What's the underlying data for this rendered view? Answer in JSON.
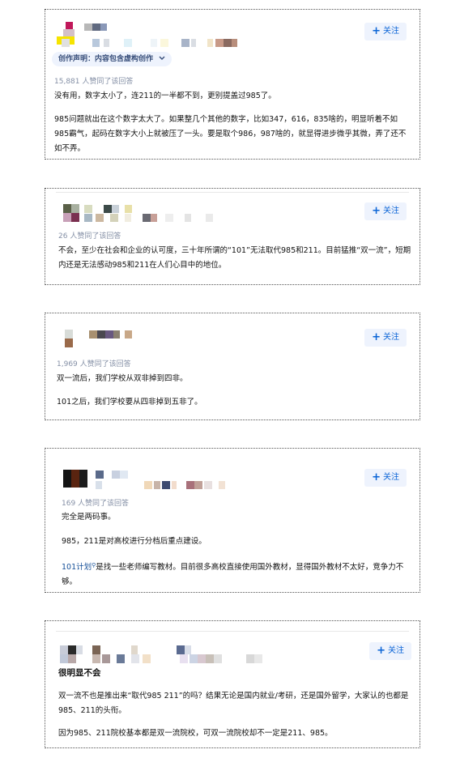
{
  "answers": [
    {
      "follow_label": "关注",
      "creation_declaration": "创作声明：内容包含虚构创作",
      "likes": "15,881 人赞同了该回答",
      "paragraphs": [
        "没有用，数字太小了，连211的一半都不到，更别提盖过985了。",
        "985问题就出在这个数字太大了。如果整几个其他的数字，比如347，616，835啥的，明显听着不如985霸气，起码在数字大小上就被压了一头。要是取个986，987啥的，就显得进步微乎其微，弄了还不如不弄。"
      ]
    },
    {
      "follow_label": "关注",
      "likes": "26 人赞同了该回答",
      "paragraphs": [
        "不会，至少在社会和企业的认可度，三十年所谓的“101”无法取代985和211。目前猛推“双一流”，短期内还是无法感动985和211在人们心目中的地位。"
      ]
    },
    {
      "follow_label": "关注",
      "likes": "1,969 人赞同了该回答",
      "paragraphs": [
        "双一流后，我们学校从双非掉到四非。",
        "101之后，我们学校要从四非掉到五非了。"
      ]
    },
    {
      "follow_label": "关注",
      "likes": "169 人赞同了该回答",
      "paragraphs": [
        "完全是两码事。",
        "985，211是对高校进行分档后重点建设。"
      ],
      "link_text": "101计划",
      "link_tail": "是找一些老师编写教材。目前很多高校直接使用国外教材，显得国外教材不太好，竞争力不够。"
    },
    {
      "follow_label": "关注",
      "title": "很明显不会",
      "paragraphs": [
        "双一流不也是推出来“取代985 211”的吗？结果无论是国内就业/考研，还是国外留学，大家认的也都是985、211的头衔。",
        "因为985、211院校基本都是双一流院校，可双一流院校却不一定是211、985。"
      ]
    }
  ],
  "colors": {
    "accent": "#0a64d6",
    "meta": "#8590a6",
    "link": "#175199",
    "follow_bg": "#eef3fd"
  },
  "icons": {
    "follow": "plus-icon",
    "declaration": "chevron-down-icon",
    "link": "search-icon"
  }
}
